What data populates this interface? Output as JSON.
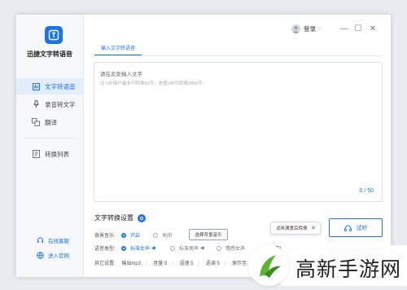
{
  "app": {
    "title": "迅捷文字转语音"
  },
  "sidebar": {
    "items": [
      {
        "label": "文字转语音",
        "icon": "text-to-speech-icon",
        "active": true
      },
      {
        "label": "录音转文字",
        "icon": "microphone-icon",
        "active": false
      },
      {
        "label": "翻译",
        "icon": "translate-icon",
        "active": false
      },
      {
        "label": "转换列表",
        "icon": "list-icon",
        "active": false
      }
    ],
    "footer": [
      {
        "label": "在线客服",
        "icon": "support-icon"
      },
      {
        "label": "进入官网",
        "icon": "website-icon"
      }
    ]
  },
  "titlebar": {
    "login": "登录",
    "minimize": "—",
    "maximize": "☐",
    "close": "✕"
  },
  "tab": {
    "label": "输入文字转语音"
  },
  "editor": {
    "placeholder_title": "请在此处输入文字",
    "placeholder_hint": "注:VIP用户最多可转换50字，充值VIP可转换2000字。",
    "counter": "0 / 50"
  },
  "settings": {
    "title": "文字转换设置",
    "bgm_label": "背景音乐:",
    "bgm_on": "开启",
    "bgm_off": "关闭",
    "bgm_choose": "选择背景音乐",
    "voice_label": "语音类型:",
    "voices": [
      "标准女声",
      "标准男声",
      "情感女声",
      "情感男声"
    ],
    "other_label": "其它设置:",
    "other_values": [
      "输出mp3",
      "音量 5",
      "语速 5",
      "语调 5",
      "保存至:"
    ]
  },
  "tooltip": {
    "text": "试听满意后转换"
  },
  "listen": {
    "label": "试听"
  },
  "watermark": {
    "text": "高新手游网"
  },
  "colors": {
    "accent": "#1a73e8",
    "sidebar_bg": "#f6f8fb",
    "active_bg": "#e4edfb"
  }
}
